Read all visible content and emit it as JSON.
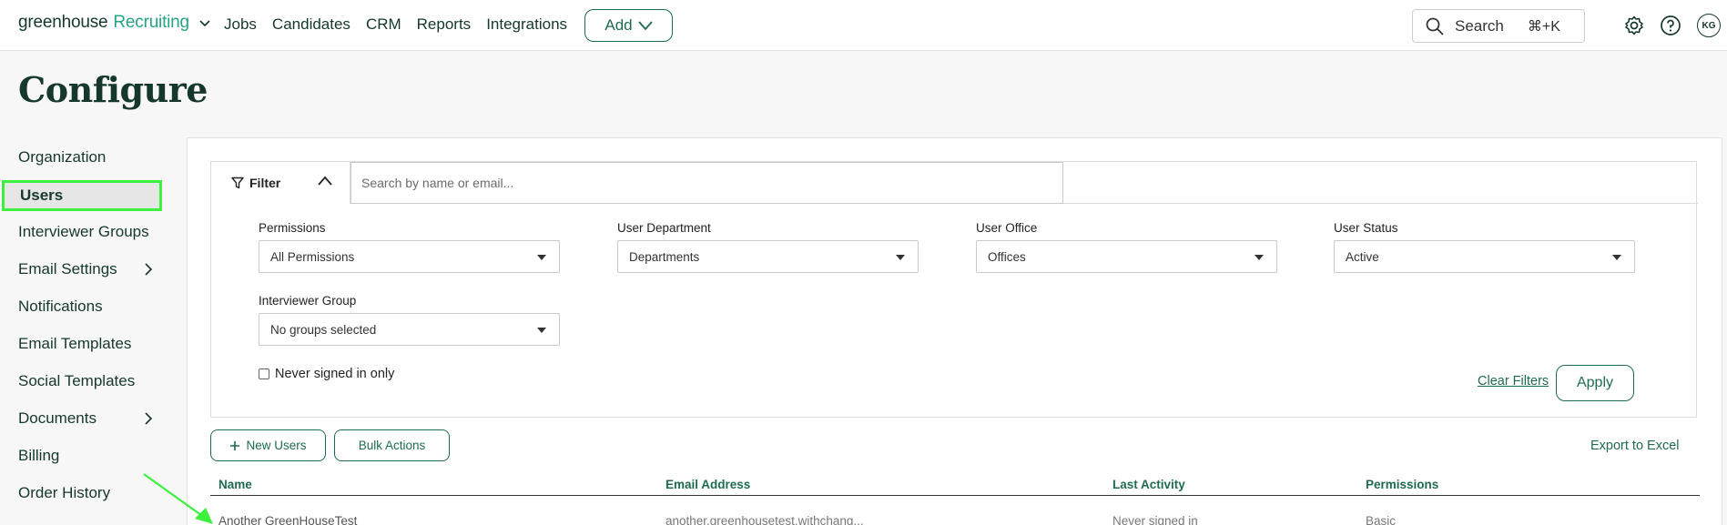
{
  "topbar": {
    "logo_main": "greenhouse",
    "logo_product": "Recruiting",
    "nav": [
      "Jobs",
      "Candidates",
      "CRM",
      "Reports",
      "Integrations"
    ],
    "add_label": "Add",
    "search_label": "Search",
    "search_shortcut": "⌘+K",
    "avatar_initials": "KG"
  },
  "page": {
    "title": "Configure"
  },
  "sidebar": {
    "items": [
      {
        "label": "Organization",
        "has_submenu": false
      },
      {
        "label": "Users",
        "has_submenu": false,
        "active": true
      },
      {
        "label": "Interviewer Groups",
        "has_submenu": false
      },
      {
        "label": "Email Settings",
        "has_submenu": true
      },
      {
        "label": "Notifications",
        "has_submenu": false
      },
      {
        "label": "Email Templates",
        "has_submenu": false
      },
      {
        "label": "Social Templates",
        "has_submenu": false
      },
      {
        "label": "Documents",
        "has_submenu": true
      },
      {
        "label": "Billing",
        "has_submenu": false
      },
      {
        "label": "Order History",
        "has_submenu": false
      }
    ]
  },
  "filter": {
    "tab_label": "Filter",
    "search_placeholder": "Search by name or email...",
    "permissions_label": "Permissions",
    "permissions_value": "All Permissions",
    "department_label": "User Department",
    "department_value": "Departments",
    "office_label": "User Office",
    "office_value": "Offices",
    "status_label": "User Status",
    "status_value": "Active",
    "group_label": "Interviewer Group",
    "group_value": "No groups selected",
    "never_signed_label": "Never signed in only",
    "clear_label": "Clear Filters",
    "apply_label": "Apply"
  },
  "actions": {
    "new_users_label": "New Users",
    "bulk_actions_label": "Bulk Actions",
    "export_label": "Export to Excel"
  },
  "table": {
    "headers": [
      "Name",
      "Email Address",
      "Last Activity",
      "Permissions"
    ],
    "rows": [
      [
        "Another GreenHouseTest",
        "another.greenhousetest.withchang...",
        "Never signed in",
        "Basic"
      ]
    ]
  },
  "colors": {
    "brand_green": "#24a47f",
    "dark_green": "#1e6b52",
    "highlight": "#3df03d"
  }
}
